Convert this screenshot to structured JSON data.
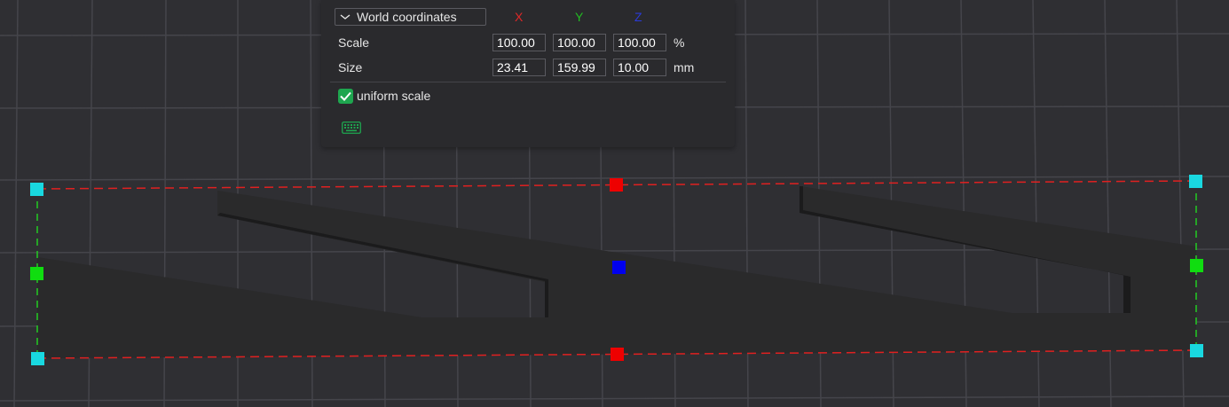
{
  "panel": {
    "coordinate_system": "World coordinates",
    "axes": {
      "x": "X",
      "y": "Y",
      "z": "Z"
    },
    "rows": {
      "scale": {
        "label": "Scale",
        "x": "100.00",
        "y": "100.00",
        "z": "100.00",
        "unit": "%"
      },
      "size": {
        "label": "Size",
        "x": "23.41",
        "y": "159.99",
        "z": "10.00",
        "unit": "mm"
      }
    },
    "uniform_scale": {
      "label": "uniform scale",
      "checked": true
    },
    "keyboard_icon": "keyboard-icon"
  },
  "colors": {
    "background": "#2f2f33",
    "grid": "#45454b",
    "model": "#2a2a2b",
    "bbox_x_edge": "#e02020",
    "bbox_y_edge": "#22cc22",
    "corner_handle": "#19d8e0",
    "x_handle": "#ee0000",
    "y_handle": "#10dd10",
    "z_handle": "#0000ee",
    "checkbox": "#1ea64f"
  }
}
